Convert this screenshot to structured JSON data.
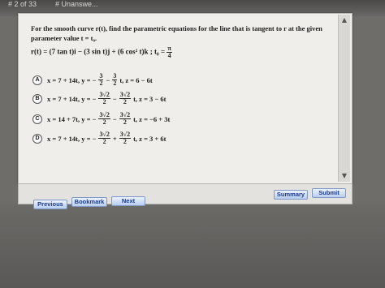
{
  "header": {
    "left_text": "# 2 of 33",
    "right_text": "# Unanswe..."
  },
  "question": {
    "prompt": "For the smooth curve r(t), find the parametric equations for the line that is tangent to r at the given parameter value t = t₀.",
    "equation_prefix": "r(t) = (7 tan t)i − (3 sin t)j + (6 cos² t)k ;  t₀ =",
    "t0_num": "π",
    "t0_den": "4"
  },
  "choices": [
    {
      "letter": "A",
      "part1": "x = 7 + 14t, y = −",
      "f1_num": "3",
      "f1_den": "2",
      "part2": "−",
      "f2_num": "3",
      "f2_den": "2",
      "part3": "t, z = 6 − 6t"
    },
    {
      "letter": "B",
      "part1": "x = 7 + 14t, y = −",
      "f1_num": "3√2",
      "f1_den": "2",
      "part2": "−",
      "f2_num": "3√2",
      "f2_den": "2",
      "part3": "t, z = 3 − 6t"
    },
    {
      "letter": "C",
      "part1": "x = 14 + 7t, y = −",
      "f1_num": "3√2",
      "f1_den": "2",
      "part2": "−",
      "f2_num": "3√2",
      "f2_den": "2",
      "part3": "t, z = −6 + 3t"
    },
    {
      "letter": "D",
      "part1": "x = 7 + 14t, y = −",
      "f1_num": "3√2",
      "f1_den": "2",
      "part2": "+",
      "f2_num": "3√2",
      "f2_den": "2",
      "part3": "t, z = 3 + 6t"
    }
  ],
  "buttons": {
    "previous": "Previous",
    "bookmark": "Bookmark",
    "next": "Next",
    "summary": "Summary",
    "submit": "Submit"
  },
  "scrollbar": {
    "up_icon": "▲",
    "down_icon": "▼"
  }
}
